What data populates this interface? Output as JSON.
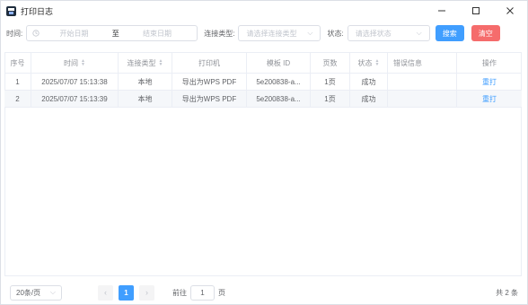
{
  "window": {
    "title": "打印日志"
  },
  "filters": {
    "time_label": "时间:",
    "start_placeholder": "开始日期",
    "range_separator": "至",
    "end_placeholder": "结束日期",
    "conn_type_label": "连接类型:",
    "conn_type_placeholder": "请选择连接类型",
    "status_label": "状态:",
    "status_placeholder": "请选择状态",
    "search_label": "搜索",
    "clear_label": "清空"
  },
  "table": {
    "columns": [
      "序号",
      "时间",
      "连接类型",
      "打印机",
      "模板 ID",
      "页数",
      "状态",
      "错误信息",
      "操作"
    ],
    "rows": [
      {
        "index": "1",
        "time": "2025/07/07 15:13:38",
        "conn_type": "本地",
        "printer": "导出为WPS PDF",
        "template_id": "5e200838-a...",
        "pages": "1页",
        "status": "成功",
        "error": "",
        "action": "重打"
      },
      {
        "index": "2",
        "time": "2025/07/07 15:13:39",
        "conn_type": "本地",
        "printer": "导出为WPS PDF",
        "template_id": "5e200838-a...",
        "pages": "1页",
        "status": "成功",
        "error": "",
        "action": "重打"
      }
    ]
  },
  "pagination": {
    "page_size": "20条/页",
    "current_page": "1",
    "goto_prefix": "前往",
    "goto_value": "1",
    "goto_suffix": "页",
    "total": "共 2 条"
  }
}
